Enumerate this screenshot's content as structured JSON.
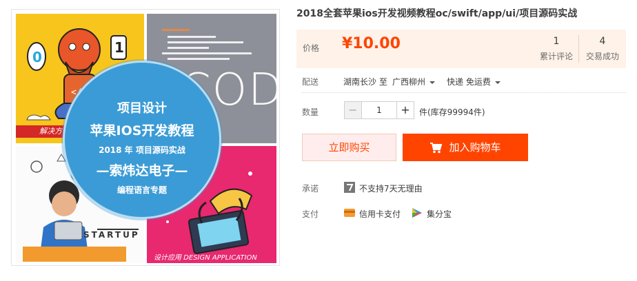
{
  "product": {
    "title": "2018全套苹果ios开发视频教程oc/swift/app/ui/项目源码实战",
    "image": {
      "circle_lines": [
        "项目设计",
        "苹果IOS开发教程",
        "2018 年 项目源码实战",
        "—索炜达电子—",
        "编程语言专题"
      ],
      "code_word": "CODE",
      "startup_word": "STARTUP",
      "yellow_strip": "解决方",
      "design_caption": "设计应用 DESIGN APPLICATION"
    }
  },
  "price": {
    "label": "价格",
    "value": "¥10.00",
    "reviews_count": "1",
    "reviews_label": "累计评论",
    "sales_count": "4",
    "sales_label": "交易成功"
  },
  "shipping": {
    "label": "配送",
    "from": "湖南长沙 至",
    "to": "广西柳州",
    "method": "快递 免运费"
  },
  "quantity": {
    "label": "数量",
    "minus": "−",
    "value": "1",
    "plus": "+",
    "stock": "件(库存99994件)"
  },
  "actions": {
    "buy_now": "立即购买",
    "add_to_cart": "加入购物车"
  },
  "promise": {
    "label": "承诺",
    "text": "不支持7天无理由",
    "icon": "seven-day-icon"
  },
  "payment": {
    "label": "支付",
    "methods": [
      {
        "label": "信用卡支付",
        "icon": "credit-card-icon"
      },
      {
        "label": "集分宝",
        "icon": "jifenbao-icon"
      }
    ]
  },
  "colors": {
    "accent": "#ff4400",
    "price_bg": "#fff2e8",
    "circle": "#3b9bd6"
  }
}
